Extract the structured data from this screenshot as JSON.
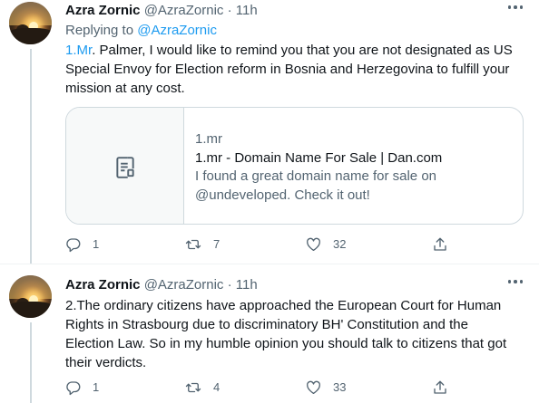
{
  "tweets": [
    {
      "author_name": "Azra Zornic",
      "handle": "@AzraZornic",
      "separator": "·",
      "time": "11h",
      "replying_label": "Replying to",
      "replying_to": "@AzraZornic",
      "text_link": "1.Mr",
      "text_rest_line1": ". Palmer, I would like to remind you that you are not designated as US",
      "text_line2": "Special Envoy for Election reform in Bosnia and Herzegovina to fulfill your",
      "text_line3": "mission at any cost.",
      "card": {
        "domain": "1.mr",
        "title": "1.mr - Domain Name For Sale | Dan.com",
        "desc_line1": "I found a great domain name for sale on",
        "desc_line2": "@undeveloped. Check it out!",
        "thumb_icon": "document-icon"
      },
      "actions": {
        "replies": "1",
        "retweets": "7",
        "likes": "32"
      }
    },
    {
      "author_name": "Azra Zornic",
      "handle": "@AzraZornic",
      "separator": "·",
      "time": "11h",
      "text_line1": "2.The ordinary citizens have approached the European Court for Human",
      "text_line2": "Rights in Strasbourg due to discriminatory BH' Constitution and the",
      "text_line3": "Election Law. So in my humble opinion you should talk to citizens that got",
      "text_line4": "their verdicts.",
      "actions": {
        "replies": "1",
        "retweets": "4",
        "likes": "33"
      }
    }
  ],
  "colors": {
    "link": "#1d9bf0",
    "muted": "#536471",
    "text": "#0f1419",
    "border": "#cfd9de"
  }
}
